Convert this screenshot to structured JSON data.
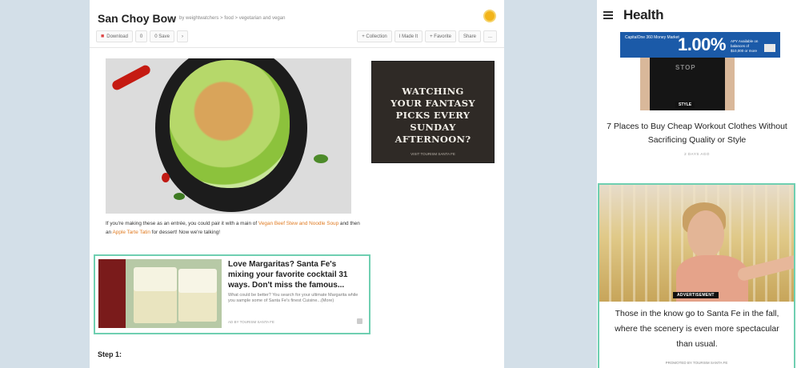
{
  "desktop": {
    "title": "San Choy Bow",
    "byline": "by weightwatchers > food > vegetarian and vegan",
    "toolbar": {
      "download": "Download",
      "count": "0",
      "save": "0 Save",
      "collection": "+ Collection",
      "made_it": "I Made It",
      "favorite": "+ Favorite",
      "share": "Share",
      "more": "..."
    },
    "ad": {
      "headline": "WATCHING YOUR FANTASY PICKS EVERY SUNDAY AFTERNOON?",
      "footer": "VISIT TOURISM SANTA FE"
    },
    "paragraph": {
      "pre": "If you're making these as an entrée, you could pair it with a main of ",
      "link1": "Vegan Beef Stew and Noodle Soup",
      "mid": " and then an ",
      "link2": "Apple Tarte Tatin",
      "post": " for dessert! Now we're talking!"
    },
    "native_ad": {
      "title": "Love Margaritas? Santa Fe's mixing your favorite cocktail 31 ways. Don't miss the famous...",
      "body": "What could be better? You search for your ultimate Margarita while you sample some of Santa Fe's finest Cuisine...(More)",
      "sponsor": "AD BY TOURISM SANTA FE"
    },
    "step": "Step 1:"
  },
  "mobile": {
    "brand": "Health",
    "banner": {
      "brand": "CapitalOne 360 Money Market",
      "rate": "1.00%",
      "rate_note": "APY Available on balances of $10,000 or more",
      "cta": ""
    },
    "shirt_text": "STOP",
    "style_tag": "STYLE",
    "article": {
      "headline": "7 Places to Buy Cheap Workout Clothes Without Sacrificing Quality or Style",
      "date": "2 DAYS AGO"
    },
    "sponsored": {
      "tag": "ADVERTISEMENT",
      "text": "Those in the know go to Santa Fe in the fall, where the scenery is even more spectacular than usual.",
      "promoted": "PROMOTED BY TOURISM SANTA FE"
    }
  },
  "colors": {
    "background": "#d3dfe8",
    "accent_link": "#e07b22",
    "native_border": "#6fcfb1",
    "banner_blue": "#1b5aa8"
  }
}
